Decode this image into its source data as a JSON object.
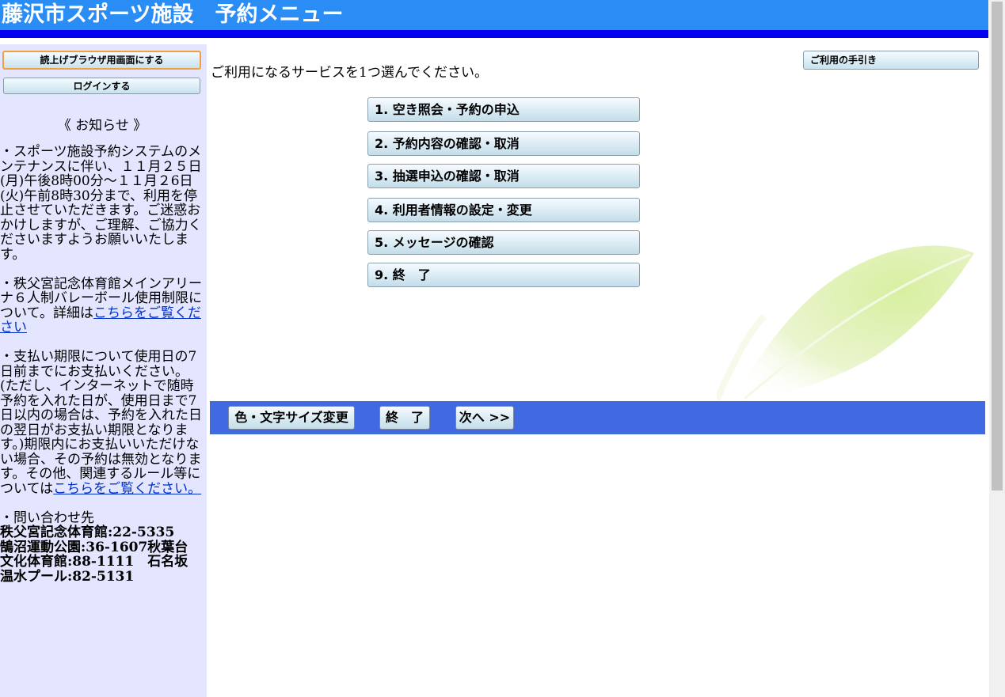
{
  "header": {
    "title": "藤沢市スポーツ施設　予約メニュー"
  },
  "sidebar": {
    "reader_button": "読上げブラウザ用画面にする",
    "login_button": "ログインする",
    "notice_title": "《 お知らせ 》",
    "notice1": "・スポーツ施設予約システムのメンテナンスに伴い、１１月２５日(月)午後8時00分～１１月２6日(火)午前8時30分まで、利用を停止させていただきます。ご迷惑おかけしますが、ご理解、ご協力くださいますようお願いいたします。",
    "notice2_text": "・秩父宮記念体育館メインアリーナ６人制バレーボール使用制限について。詳細は",
    "notice2_link": "こちらをご覧ください",
    "notice3_text": "・支払い期限について使用日の7日前までにお支払いください。(ただし、インターネットで随時予約を入れた日が、使用日まで7日以内の場合は、予約を入れた日の翌日がお支払い期限となります。)期限内にお支払いいただけない場合、その予約は無効となります。その他、関連するルール等については",
    "notice3_link": "こちらをご覧ください。",
    "contact_title": "・問い合わせ先",
    "contact_lines": [
      "秩父宮記念体育館:22-5335",
      "鵠沼運動公園:36-1607秋葉台",
      "文化体育館:88-1111　石名坂",
      "温水プール:82-5131"
    ]
  },
  "main": {
    "instruction": "ご利用になるサービスを1つ選んでください。",
    "help_button": "ご利用の手引き",
    "menu": [
      "1. 空き照会・予約の申込",
      "2. 予約内容の確認・取消",
      "3. 抽選申込の確認・取消",
      "4. 利用者情報の設定・変更",
      "5. メッセージの確認",
      "9. 終　了"
    ]
  },
  "footer": {
    "color_button": "色・文字サイズ変更",
    "exit_button": "終　了",
    "next_button": "次へ >>"
  },
  "colors": {
    "header": "#2a8df5",
    "header_bar": "#0000f0",
    "sidebar": "#e4e6ff",
    "footer_bar": "#4169e1",
    "link": "#0030c8"
  }
}
